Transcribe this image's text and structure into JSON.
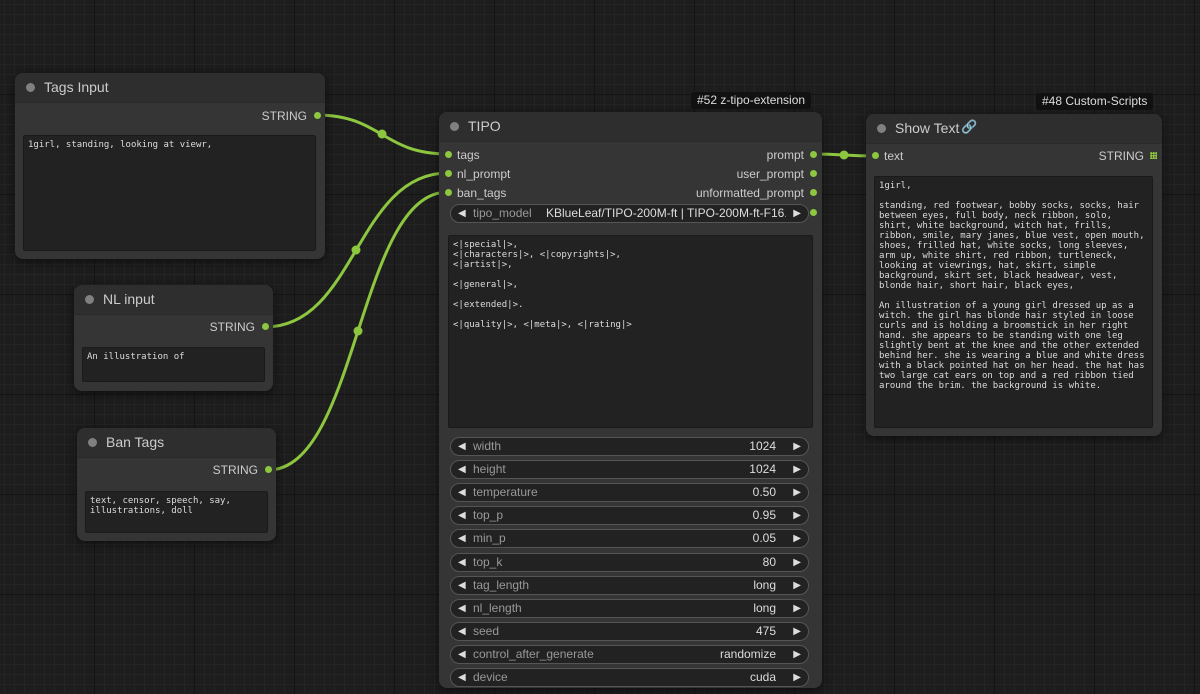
{
  "links_color": "#8dc63f",
  "slot_color": "#8dc63f",
  "nodes": {
    "tags_input": {
      "title": "Tags Input",
      "output_type": "STRING",
      "text": "1girl, standing, looking at viewr,"
    },
    "nl_input": {
      "title": "NL input",
      "output_type": "STRING",
      "text": "An illustration of"
    },
    "ban_tags": {
      "title": "Ban Tags",
      "output_type": "STRING",
      "text": "text, censor, speech, say, illustrations, doll"
    },
    "tipo": {
      "badge": "#52 z-tipo-extension",
      "title": "TIPO",
      "inputs": [
        "tags",
        "nl_prompt",
        "ban_tags"
      ],
      "outputs": [
        "prompt",
        "user_prompt",
        "unformatted_prompt"
      ],
      "model_widget": {
        "name": "tipo_model",
        "value": "KBlueLeaf/TIPO-200M-ft | TIPO-200M-ft-F16..."
      },
      "format_text": "<|special|>,\n<|characters|>, <|copyrights|>,\n<|artist|>,\n\n<|general|>,\n\n<|extended|>.\n\n<|quality|>, <|meta|>, <|rating|>",
      "widgets": [
        {
          "name": "width",
          "value": "1024"
        },
        {
          "name": "height",
          "value": "1024"
        },
        {
          "name": "temperature",
          "value": "0.50"
        },
        {
          "name": "top_p",
          "value": "0.95"
        },
        {
          "name": "min_p",
          "value": "0.05"
        },
        {
          "name": "top_k",
          "value": "80"
        },
        {
          "name": "tag_length",
          "value": "long"
        },
        {
          "name": "nl_length",
          "value": "long"
        },
        {
          "name": "seed",
          "value": "475"
        },
        {
          "name": "control_after_generate",
          "value": "randomize"
        },
        {
          "name": "device",
          "value": "cuda"
        }
      ]
    },
    "show_text": {
      "badge": "#48 Custom-Scripts",
      "title": "Show Text",
      "icon": "link-icon",
      "input": "text",
      "output_type": "STRING",
      "text": "1girl,\n\nstanding, red footwear, bobby socks, socks, hair between eyes, full body, neck ribbon, solo, shirt, white background, witch hat, frills, ribbon, smile, mary janes, blue vest, open mouth, shoes, frilled hat, white socks, long sleeves, arm up, white shirt, red ribbon, turtleneck, looking at viewrings, hat, skirt, simple background, skirt set, black headwear, vest, blonde hair, short hair, black eyes,\n\nAn illustration of a young girl dressed up as a witch. the girl has blonde hair styled in loose curls and is holding a broomstick in her right hand. she appears to be standing with one leg slightly bent at the knee and the other extended behind her. she is wearing a blue and white dress with a black pointed hat on her head. the hat has two large cat ears on top and a red ribbon tied around the brim. the background is white."
    }
  }
}
